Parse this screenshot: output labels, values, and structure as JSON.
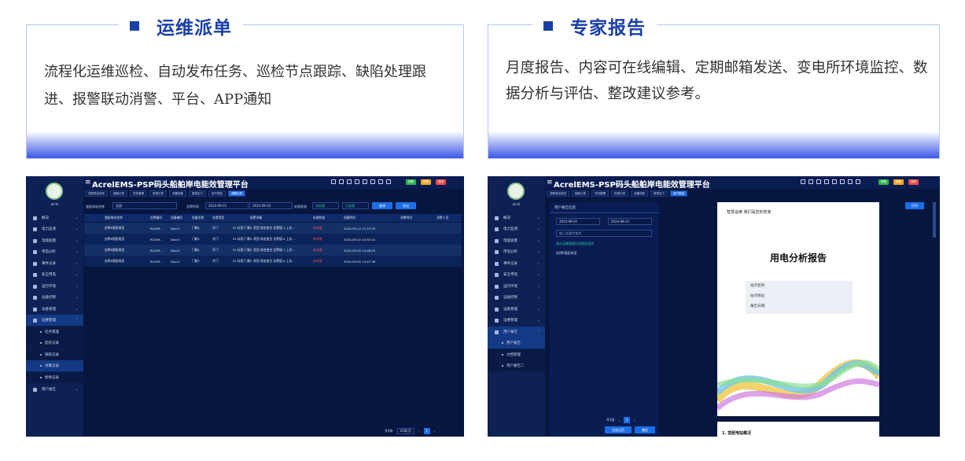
{
  "cards": [
    {
      "title": "运维派单",
      "text": "流程化运维巡检、自动发布任务、巡检节点跟踪、缺陷处理跟进、报警联动消警、平台、APP通知"
    },
    {
      "title": "专家报告",
      "text": "月度报告、内容可在线编辑、定期邮箱发送、变电所环境监控、数据分析与评估、整改建议参考。"
    }
  ],
  "colors": {
    "brand": "#1a3fa8",
    "gradient_end": "#3b57e6",
    "screen_bg": "#06163f",
    "sidebar_bg": "#0d2155",
    "accent": "#1c6ee8",
    "alarm_red": "#ff4d4f"
  },
  "app": {
    "title": "AcrelEMS-PSP码头船舶岸电能效管理平台",
    "logo_text": "acrel",
    "badges": [
      {
        "label": "预警",
        "color": "#2bb24c"
      },
      {
        "label": "告警",
        "color": "#f5a623"
      },
      {
        "label": "故障",
        "color": "#e84a4a"
      }
    ]
  },
  "screen_left": {
    "tabs": [
      "变配电站状态",
      "能耗记录",
      "任务管理",
      "抢修记录",
      "设备档案",
      "报表定义",
      "用户报告",
      "消警记录"
    ],
    "sidebar": [
      {
        "label": "概况"
      },
      {
        "label": "电力监测"
      },
      {
        "label": "电能质量"
      },
      {
        "label": "用电分析"
      },
      {
        "label": "事件记录"
      },
      {
        "label": "安全用电"
      },
      {
        "label": "运行环境"
      },
      {
        "label": "设备控制"
      },
      {
        "label": "设备管理"
      },
      {
        "label": "运维管理"
      }
    ],
    "sub_items": [
      "任务管理",
      "巡检记录",
      "缺陷记录",
      "消警记录",
      "抢修记录"
    ],
    "sidebar_tail": "用户报告",
    "filters": {
      "station_label": "变配电站名称",
      "station_value": "全部",
      "time_label": "告警时间",
      "date_from": "2024-09-01",
      "date_to": "2024-09-20",
      "status_label": "处理状态",
      "status_a": "未处理",
      "status_b": "已处理",
      "query": "查询",
      "export": "导出"
    },
    "columns": [
      "变配电站名称",
      "告警编号",
      "设备编号",
      "设备名称",
      "告警类型",
      "报警详情",
      "处理状态",
      "创建时间",
      "消警时间",
      "消警人员"
    ],
    "rows": [
      [
        "启明E楼配电室",
        "R2409...",
        "Door1",
        "门磁1",
        "开门",
        "01 标签:门磁1 类型:状态变位 告警值:1 上次...",
        "未处理",
        "2024-09-12 11:27:20",
        "",
        ""
      ],
      [
        "启明E楼配电室",
        "R2409...",
        "Door1",
        "门磁1",
        "关门",
        "01 标签:门磁1 类型:状态变位 告警值:0 上次...",
        "未处理",
        "2024-09-02 14:52:41",
        "",
        ""
      ],
      [
        "启明E楼配电室",
        "R2409...",
        "Door1",
        "门磁1",
        "开门",
        "01 标签:门磁1 类型:状态变位 告警值:1 上次...",
        "未处理",
        "2024-09-02 14:48:25",
        "",
        ""
      ],
      [
        "启明E楼配电室",
        "R2409...",
        "Door1",
        "门磁1",
        "关门",
        "01 标签:门磁1 类型:状态变位 告警值:0 上次...",
        "未处理",
        "2024-09-02 14:47:46",
        "",
        ""
      ]
    ],
    "pager": {
      "total": "共4条",
      "size": "20条/页",
      "page": "1"
    }
  },
  "screen_right": {
    "tabs": [
      "变配电站状态",
      "能耗记录",
      "任务管理",
      "抢修记录",
      "设备档案",
      "报表定义",
      "用户报告"
    ],
    "sidebar": [
      {
        "label": "概况"
      },
      {
        "label": "电力监测"
      },
      {
        "label": "电能质量"
      },
      {
        "label": "用电分析"
      },
      {
        "label": "事件记录"
      },
      {
        "label": "安全用电"
      },
      {
        "label": "运行环境"
      },
      {
        "label": "设备控制"
      },
      {
        "label": "设备管理"
      },
      {
        "label": "运维管理"
      },
      {
        "label": "用户报告"
      }
    ],
    "sub_items": [
      "用户报告",
      "文档管理",
      "用户报告二"
    ],
    "panel_title": "用户报告信息",
    "date_from": "2024-08-01",
    "date_to": "2024-08-31",
    "search_placeholder": "输入关键字查询",
    "list": [
      "瑞士运维管理后台报告测试",
      "启明E楼配电室"
    ],
    "pager": {
      "total": "共1条",
      "page": "1"
    },
    "btn_select_all": "全选当页",
    "btn_confirm": "确定",
    "print": "打印",
    "doc": {
      "header": "智慧运维 我们是您的管家",
      "title": "用电分析报告",
      "fields": [
        "站点名称:",
        "站点地址:",
        "报告日期:"
      ],
      "section": "1. 变配电站概况"
    }
  }
}
